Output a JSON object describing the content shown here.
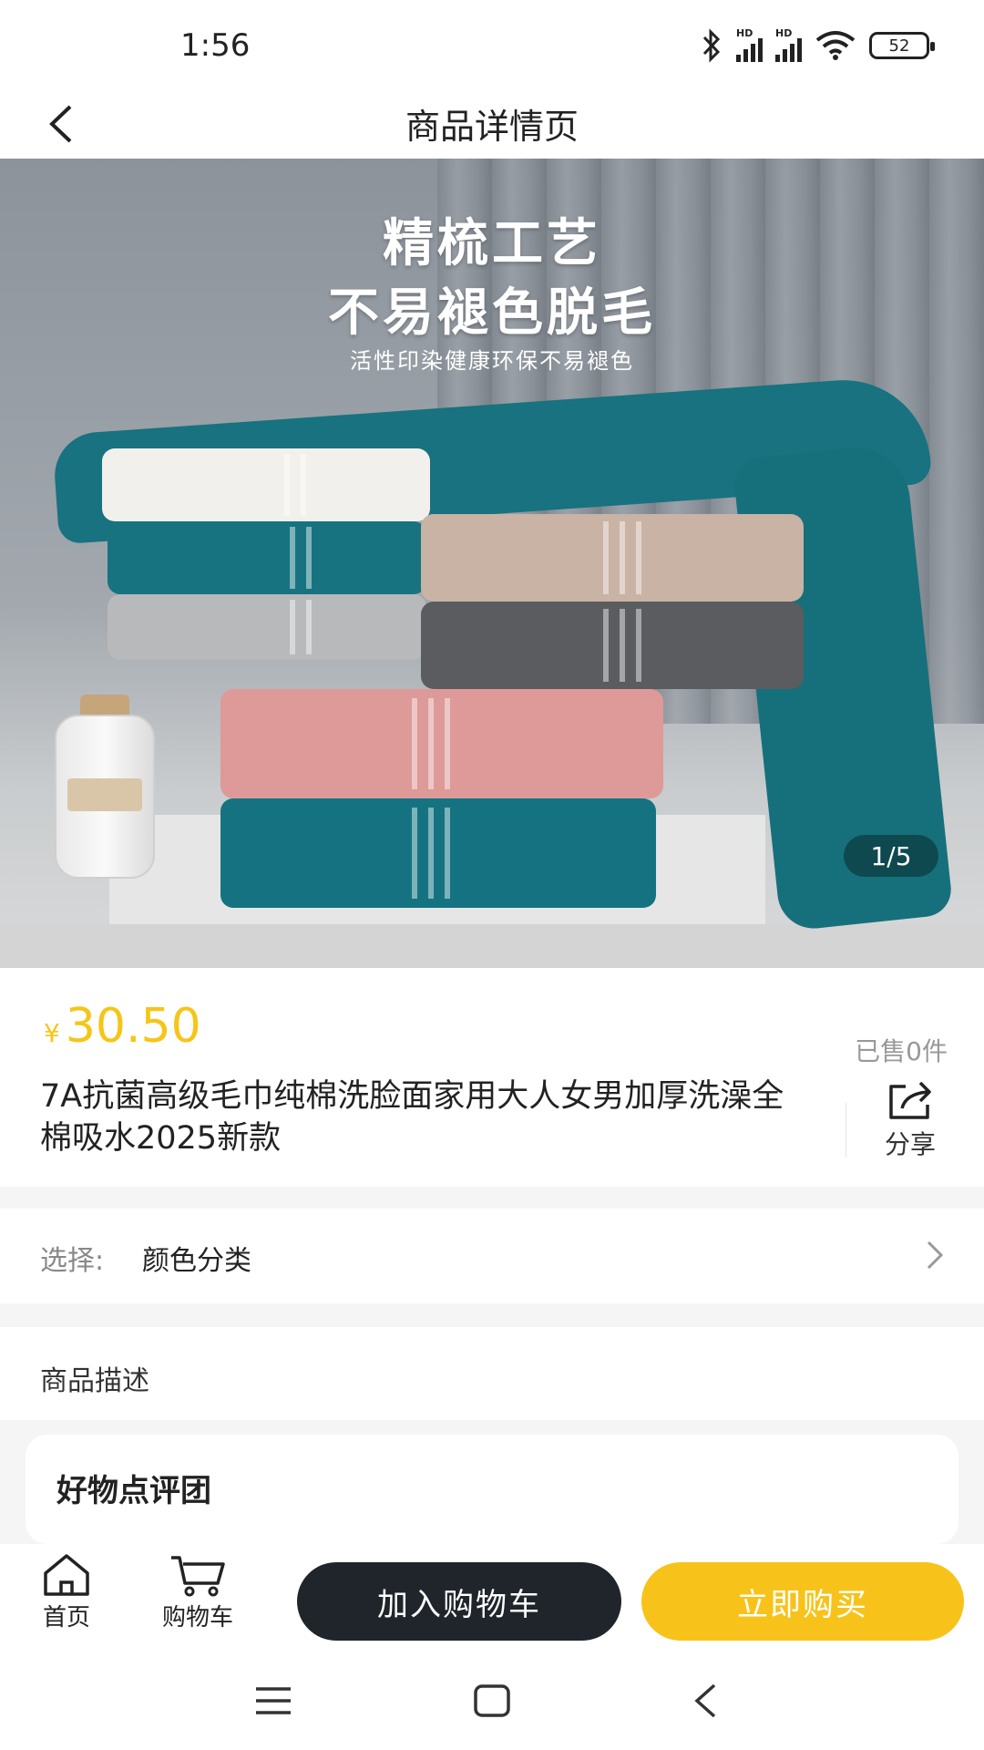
{
  "status_bar": {
    "time": "1:56",
    "network_tag": "HD",
    "battery": "52"
  },
  "header": {
    "title": "商品详情页"
  },
  "hero": {
    "headline_line1": "精梳工艺",
    "headline_line2": "不易褪色脱毛",
    "subline": "活性印染健康环保不易褪色",
    "counter": "1/5"
  },
  "product": {
    "currency": "¥",
    "price": "30.50",
    "sold": "已售0件",
    "title": "7A抗菌高级毛巾纯棉洗脸面家用大人女男加厚洗澡全棉吸水2025新款",
    "share_label": "分享",
    "accent_color": "#f5c518"
  },
  "select": {
    "label": "选择:",
    "value": "颜色分类"
  },
  "description": {
    "label": "商品描述"
  },
  "review": {
    "title": "好物点评团"
  },
  "bottom_bar": {
    "home_label": "首页",
    "cart_label": "购物车",
    "add_to_cart": "加入购物车",
    "buy_now": "立即购买"
  }
}
